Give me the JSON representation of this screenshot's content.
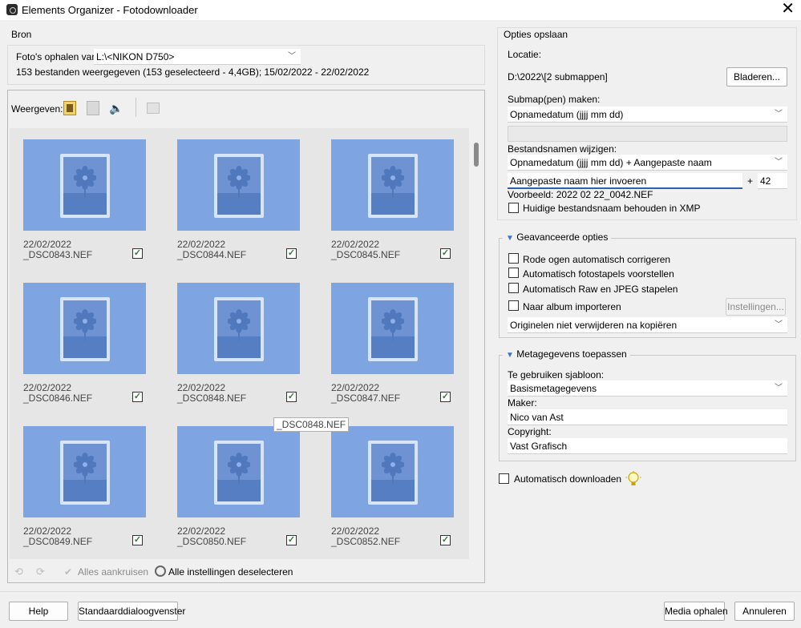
{
  "window": {
    "title": "Elements Organizer - Fotodownloader"
  },
  "source": {
    "group_label": "Bron",
    "fetch_label": "Foto's ophalen van:",
    "fetch_value": "L:\\<NIKON D750>",
    "summary": "153 bestanden weergegeven (153 geselecteerd - 4,4GB); 15/02/2022 - 22/02/2022"
  },
  "view": {
    "label": "Weergeven:"
  },
  "thumbnails": [
    {
      "date": "22/02/2022",
      "name": "_DSC0843.NEF",
      "checked": true
    },
    {
      "date": "22/02/2022",
      "name": "_DSC0844.NEF",
      "checked": true
    },
    {
      "date": "22/02/2022",
      "name": "_DSC0845.NEF",
      "checked": true
    },
    {
      "date": "22/02/2022",
      "name": "_DSC0846.NEF",
      "checked": true
    },
    {
      "date": "22/02/2022",
      "name": "_DSC0848.NEF",
      "checked": true
    },
    {
      "date": "22/02/2022",
      "name": "_DSC0847.NEF",
      "checked": true
    },
    {
      "date": "22/02/2022",
      "name": "_DSC0849.NEF",
      "checked": true
    },
    {
      "date": "22/02/2022",
      "name": "_DSC0850.NEF",
      "checked": true
    },
    {
      "date": "22/02/2022",
      "name": "_DSC0852.NEF",
      "checked": true
    }
  ],
  "tooltip": "_DSC0848.NEF",
  "bottom_toolbar": {
    "check_all": "Alles aankruisen",
    "deselect_all": "Alle instellingen deselecteren"
  },
  "save": {
    "group_label": "Opties opslaan",
    "location_label": "Locatie:",
    "location_value": "D:\\2022\\[2 submappen]",
    "browse_button": "Bladeren...",
    "subfolder_label": "Submap(pen) maken:",
    "subfolder_value": "Opnamedatum (jjjj mm dd)",
    "rename_label": "Bestandsnamen wijzigen:",
    "rename_value": "Opnamedatum (jjjj mm dd) + Aangepaste naam",
    "custom_name": "Aangepaste naam hier invoeren",
    "plus": "+",
    "number": "42",
    "preview": "Voorbeeld: 2022 02 22_0042.NEF",
    "keep_xmp": "Huidige bestandsnaam behouden in XMP"
  },
  "advanced": {
    "group_label": "Geavanceerde opties",
    "redeye": "Rode ogen automatisch corrigeren",
    "stacks": "Automatisch fotostapels voorstellen",
    "raw_jpeg": "Automatisch Raw en JPEG stapelen",
    "album": "Naar album importeren",
    "settings_button": "Instellingen...",
    "delete_option": "Originelen niet verwijderen na kopiëren"
  },
  "metadata": {
    "group_label": "Metagegevens toepassen",
    "template_label": "Te gebruiken sjabloon:",
    "template_value": "Basismetagegevens",
    "creator_label": "Maker:",
    "creator_value": "Nico van Ast",
    "copyright_label": "Copyright:",
    "copyright_value": "Vast Grafisch"
  },
  "auto_download": "Automatisch downloaden",
  "footer": {
    "help": "Help",
    "standard_dialog": "Standaarddialoogvenster",
    "get_media": "Media ophalen",
    "cancel": "Annuleren"
  }
}
